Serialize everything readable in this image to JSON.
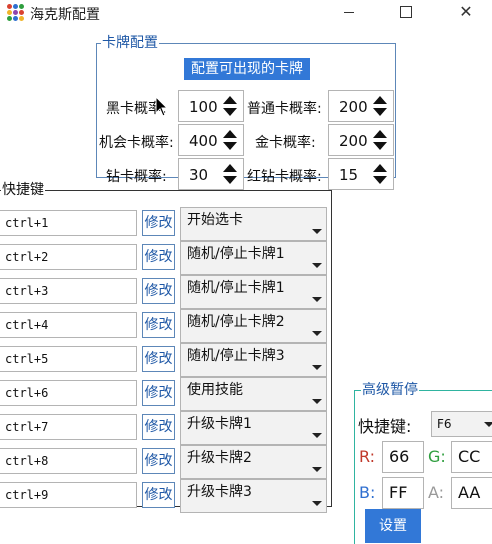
{
  "window": {
    "title": "海克斯配置",
    "controls": {
      "minimize": "minimize-icon",
      "maximize": "maximize-icon",
      "close": "✕"
    }
  },
  "card_config": {
    "group_title": "卡牌配置",
    "header": "配置可出现的卡牌",
    "rates": [
      {
        "label": "黑卡概率:",
        "value": "100"
      },
      {
        "label": "普通卡概率:",
        "value": "200"
      },
      {
        "label": "机会卡概率:",
        "value": "400"
      },
      {
        "label": "金卡概率:",
        "value": "200"
      },
      {
        "label": "钻卡概率:",
        "value": "30"
      },
      {
        "label": "红钻卡概率:",
        "value": "15"
      }
    ]
  },
  "shortcuts": {
    "group_title": "快捷键",
    "edit_label": "修改",
    "rows": [
      {
        "key": "ctrl+1",
        "action": "开始选卡"
      },
      {
        "key": "ctrl+2",
        "action": "随机/停止卡牌1"
      },
      {
        "key": "ctrl+3",
        "action": "随机/停止卡牌1"
      },
      {
        "key": "ctrl+4",
        "action": "随机/停止卡牌2"
      },
      {
        "key": "ctrl+5",
        "action": "随机/停止卡牌3"
      },
      {
        "key": "ctrl+6",
        "action": "使用技能"
      },
      {
        "key": "ctrl+7",
        "action": "升级卡牌1"
      },
      {
        "key": "ctrl+8",
        "action": "升级卡牌2"
      },
      {
        "key": "ctrl+9",
        "action": "升级卡牌3"
      }
    ]
  },
  "advanced_pause": {
    "group_title": "高级暂停",
    "hotkey_label": "快捷键:",
    "hotkey_value": "F6",
    "r_label": "R:",
    "r_value": "66",
    "g_label": "G:",
    "g_value": "CC",
    "b_label": "B:",
    "b_value": "FF",
    "a_label": "A:",
    "a_value": "AA",
    "set_button": "设置"
  },
  "colors": {
    "accent": "#3278d7",
    "group_border": "#5d87b8",
    "legend_text": "#1f58a6",
    "r_color": "#c0392b",
    "g_color": "#2e9e3e",
    "b_color": "#2f6fd0",
    "a_color": "#999999"
  }
}
